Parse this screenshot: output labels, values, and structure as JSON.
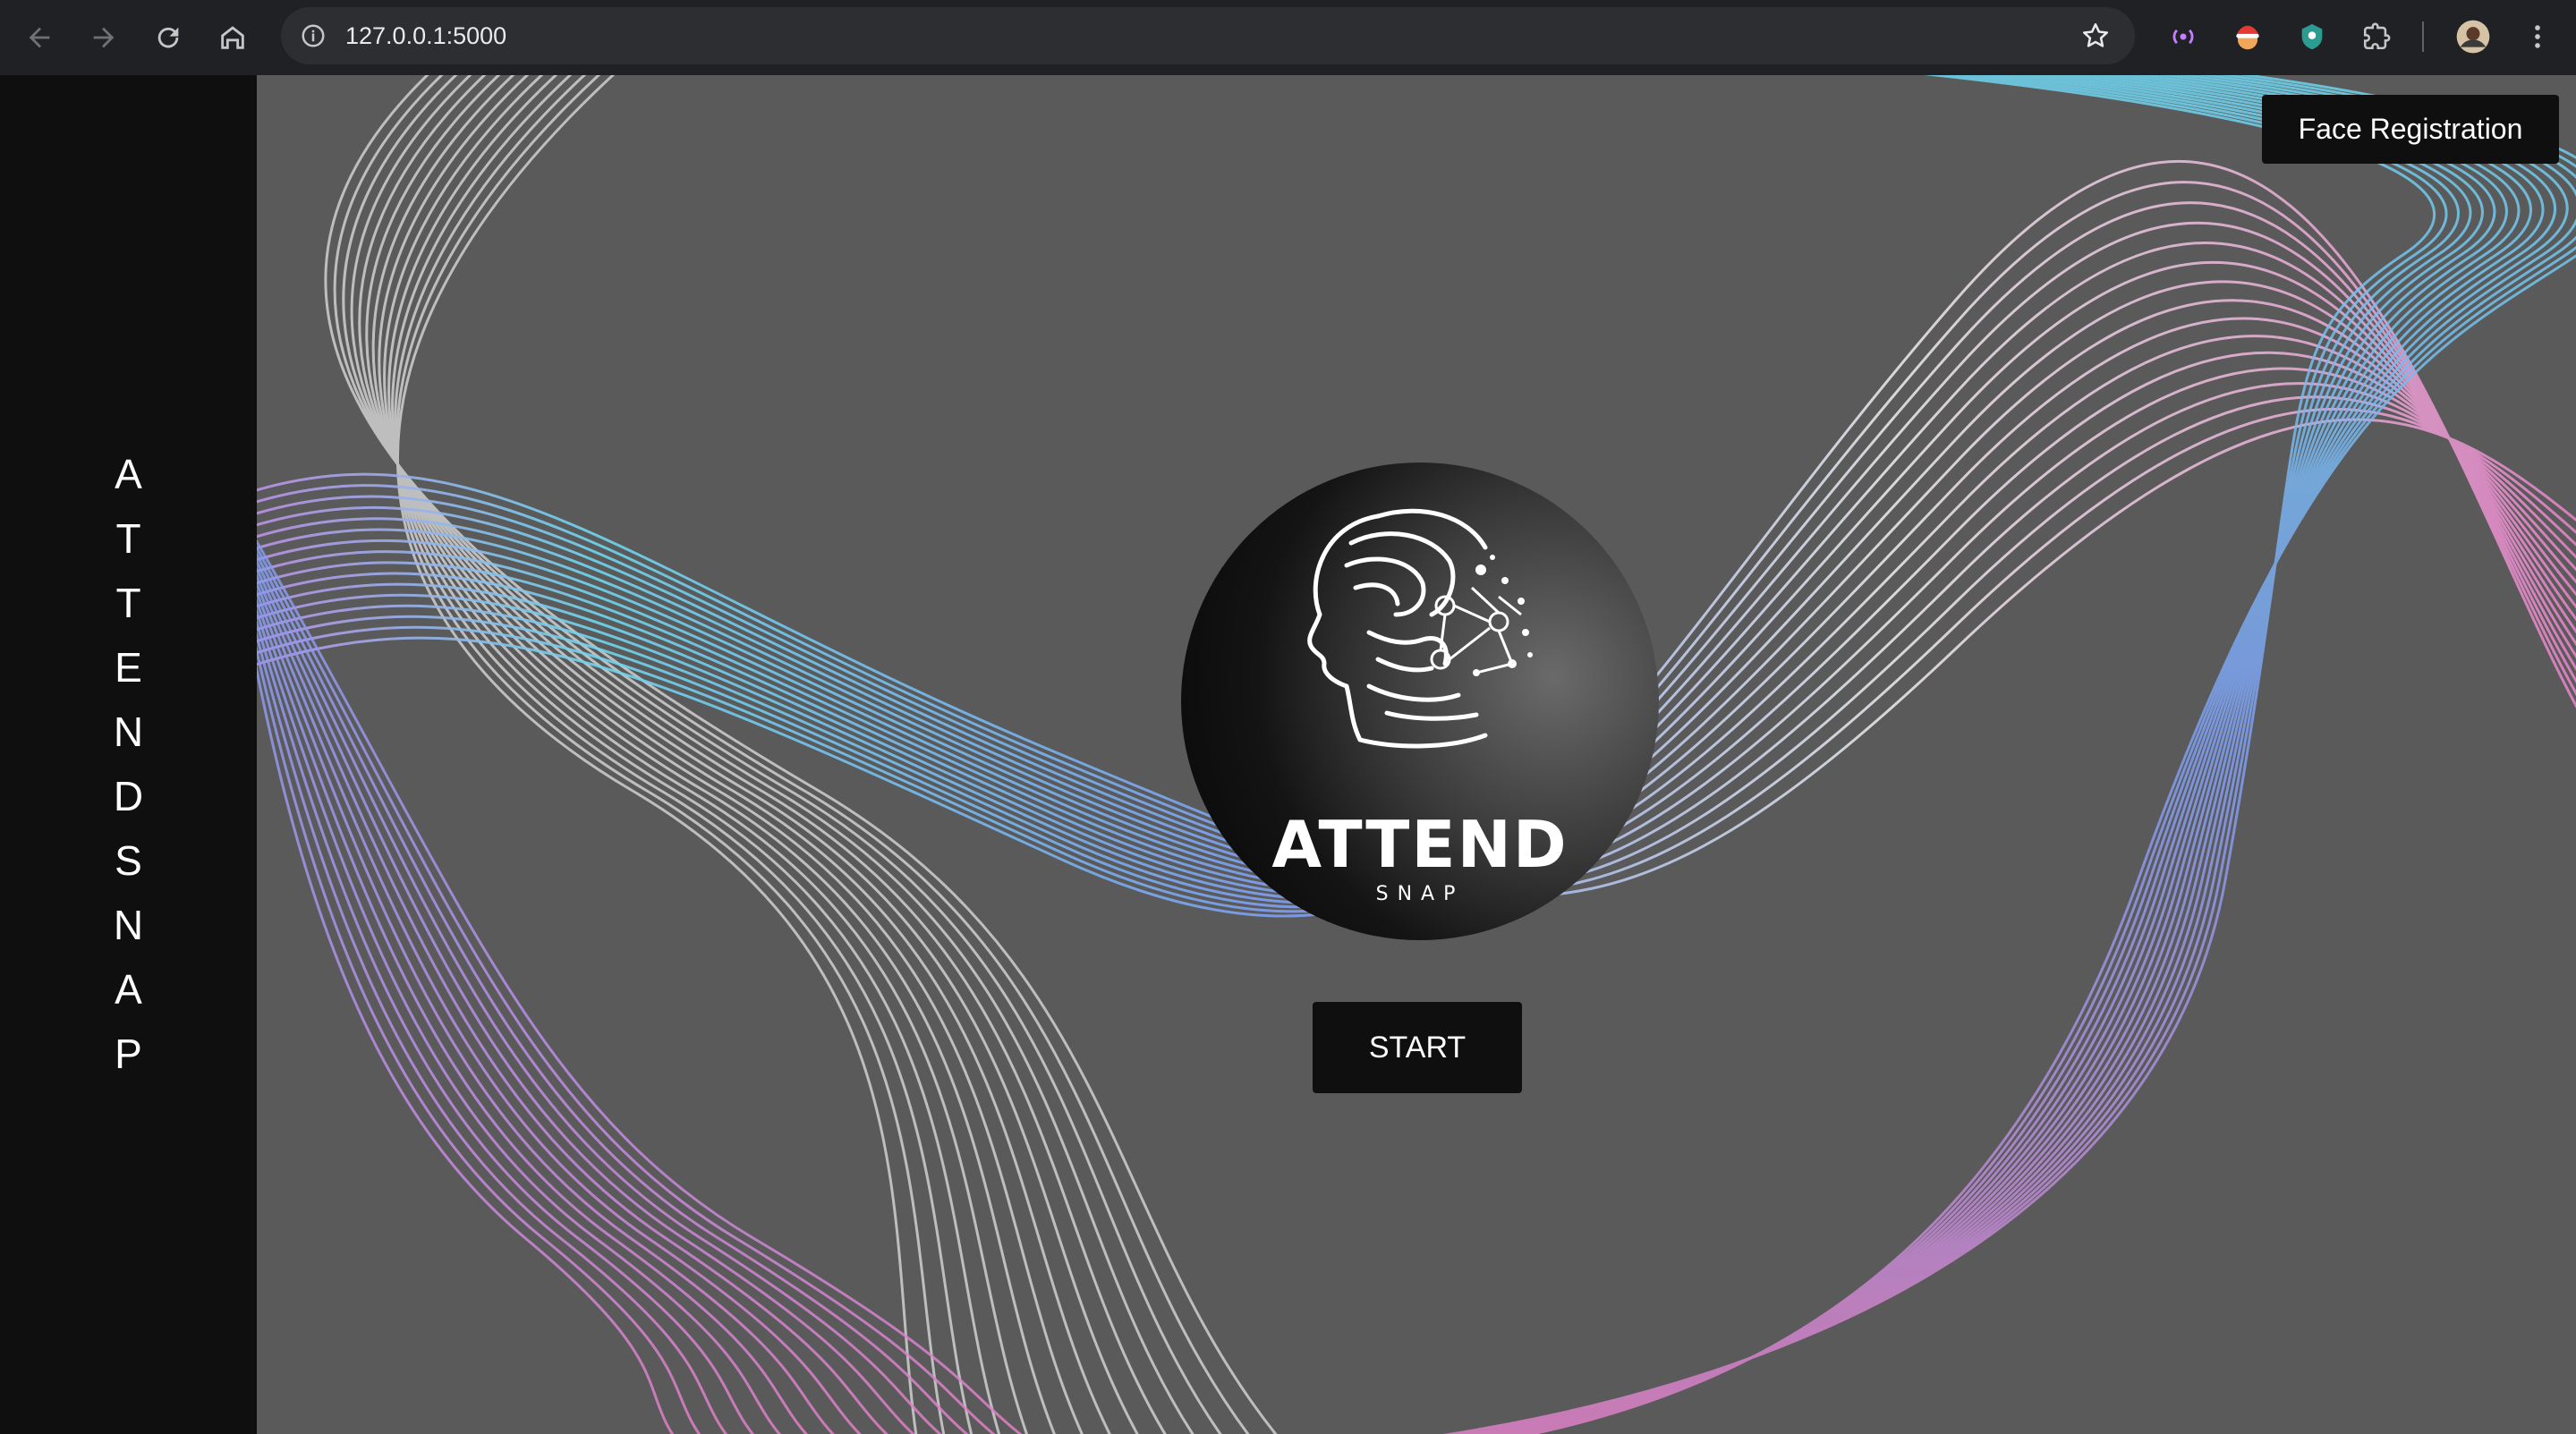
{
  "browser": {
    "url": "127.0.0.1:5000",
    "icons": {
      "back": "back-arrow-icon",
      "forward": "forward-arrow-icon",
      "reload": "reload-icon",
      "home": "home-icon",
      "site_info": "site-info-icon",
      "bookmark": "star-icon",
      "extensions": "puzzle-icon",
      "menu": "kebab-menu-icon"
    }
  },
  "sidebar": {
    "letters": [
      "A",
      "T",
      "T",
      "E",
      "N",
      "D",
      "S",
      "N",
      "A",
      "P"
    ]
  },
  "header": {
    "face_registration_label": "Face Registration"
  },
  "logo": {
    "title": "ATTEND",
    "subtitle": "SNAP"
  },
  "main": {
    "start_label": "START"
  },
  "colors": {
    "sidebar_bg": "#0f0f0f",
    "main_bg": "#5a5a5a",
    "button_bg": "#0f0f0f",
    "wave_white": "#e6e6e6",
    "wave_cyan": "#6fd6ee",
    "wave_blue": "#7f9ef0",
    "wave_pink": "#e27fc4"
  }
}
